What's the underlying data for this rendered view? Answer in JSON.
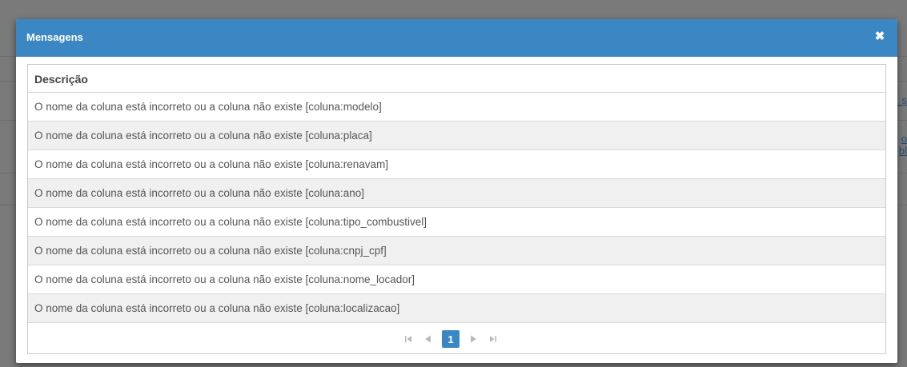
{
  "background": {
    "links": [
      "s_",
      "o",
      "bl"
    ]
  },
  "modal": {
    "title": "Mensagens",
    "close_glyph": "✖",
    "header_color": "#3a87c3"
  },
  "grid": {
    "columns": [
      "Descrição"
    ],
    "rows": [
      "O nome da coluna está incorreto ou a coluna não existe [coluna:modelo]",
      "O nome da coluna está incorreto ou a coluna não existe [coluna:placa]",
      "O nome da coluna está incorreto ou a coluna não existe [coluna:renavam]",
      "O nome da coluna está incorreto ou a coluna não existe [coluna:ano]",
      "O nome da coluna está incorreto ou a coluna não existe [coluna:tipo_combustivel]",
      "O nome da coluna está incorreto ou a coluna não existe [coluna:cnpj_cpf]",
      "O nome da coluna está incorreto ou a coluna não existe [coluna:nome_locador]",
      "O nome da coluna está incorreto ou a coluna não existe [coluna:localizacao]"
    ]
  },
  "pager": {
    "current_page": "1",
    "icons": [
      "first-page-icon",
      "previous-page-icon",
      "next-page-icon",
      "last-page-icon"
    ]
  }
}
